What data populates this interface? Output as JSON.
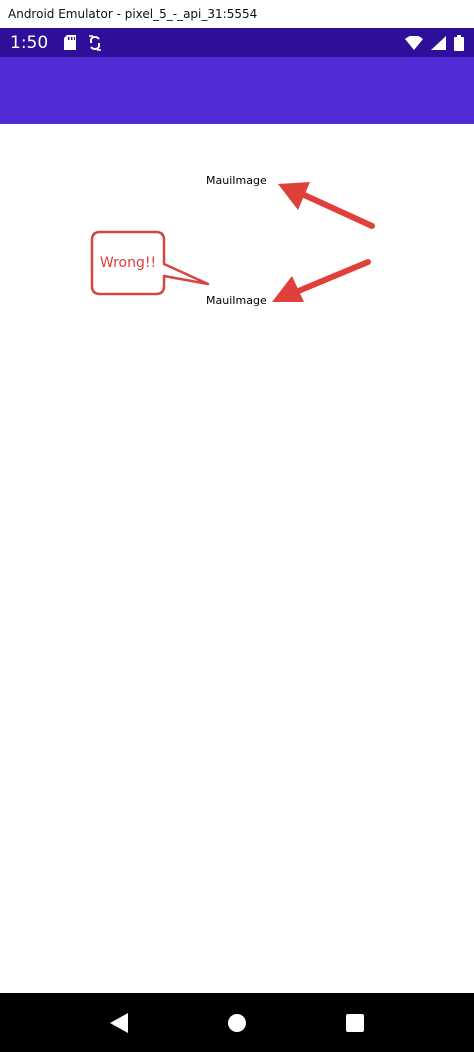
{
  "window": {
    "title": "Android Emulator - pixel_5_-_api_31:5554"
  },
  "status_bar": {
    "time": "1:50",
    "left_icons": [
      "sd-card-icon",
      "sync-icon"
    ],
    "right_icons": [
      "wifi-icon",
      "signal-icon",
      "battery-icon"
    ],
    "background": "#2d0f9a"
  },
  "app_bar": {
    "background": "#512bd4"
  },
  "content": {
    "labels": [
      "MauiImage",
      "MauiImage"
    ],
    "callout_text": "Wrong!!",
    "annotation_color": "#e0403a"
  },
  "navigation_bar": {
    "buttons": [
      "back-icon",
      "home-icon",
      "recents-icon"
    ]
  }
}
